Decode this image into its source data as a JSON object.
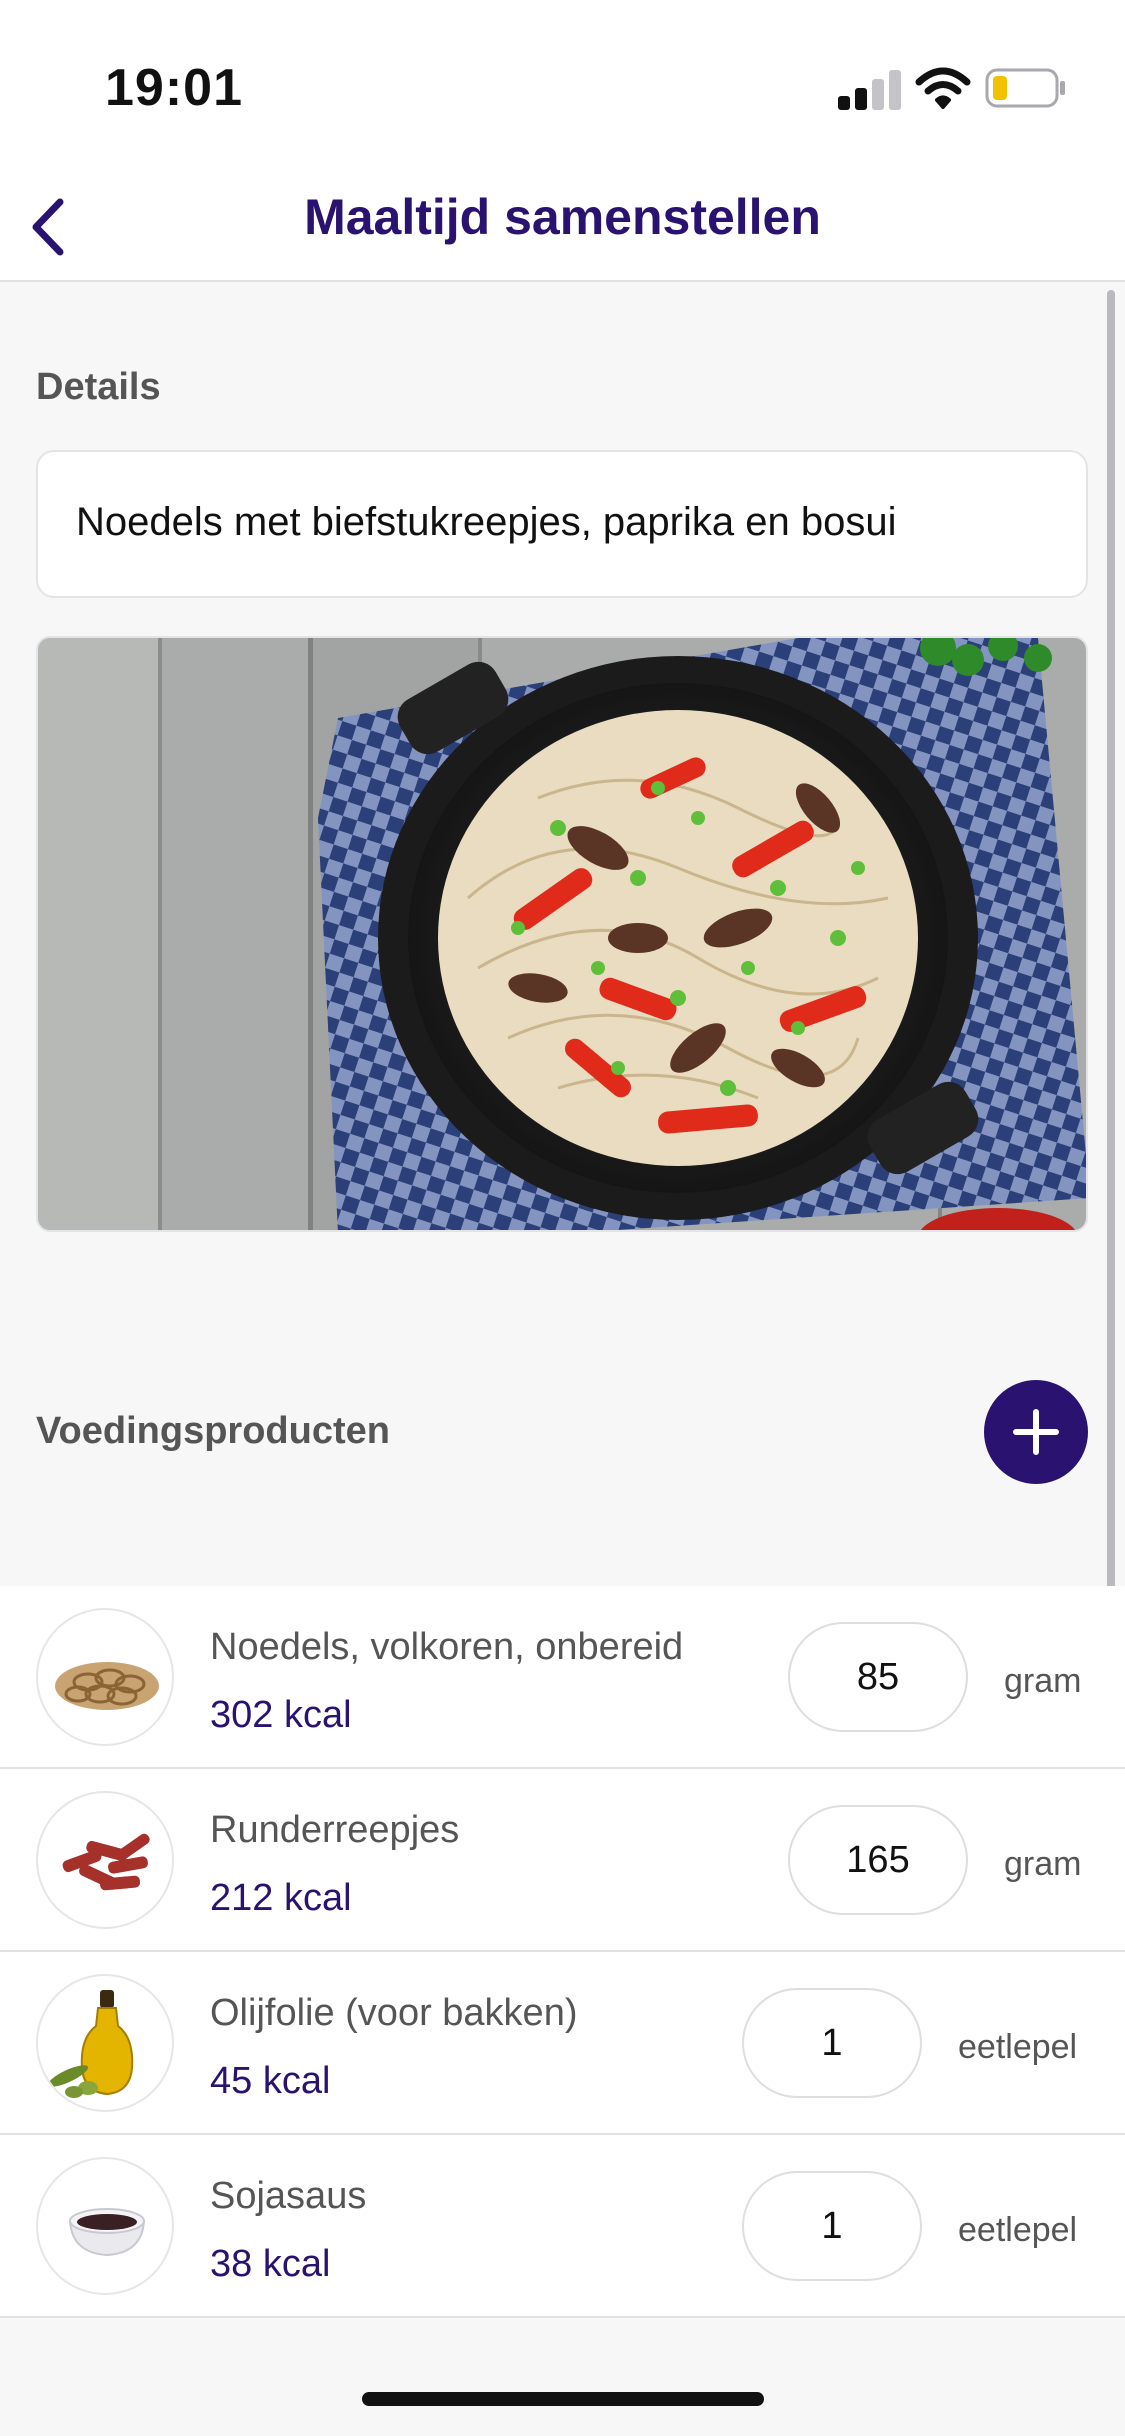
{
  "status": {
    "time": "19:01"
  },
  "nav": {
    "title": "Maaltijd samenstellen"
  },
  "details": {
    "label": "Details",
    "meal_name": "Noedels met biefstukreepjes, paprika en bosui"
  },
  "products": {
    "label": "Voedingsproducten",
    "items": [
      {
        "name": "Noedels, volkoren, onbereid",
        "kcal": "302 kcal",
        "amount": "85",
        "unit": "gram",
        "icon": "noodles-icon"
      },
      {
        "name": "Runderreepjes",
        "kcal": "212 kcal",
        "amount": "165",
        "unit": "gram",
        "icon": "beef-strips-icon"
      },
      {
        "name": "Olijfolie (voor bakken)",
        "kcal": "45 kcal",
        "amount": "1",
        "unit": "eetlepel",
        "icon": "olive-oil-icon"
      },
      {
        "name": "Sojasaus",
        "kcal": "38 kcal",
        "amount": "1",
        "unit": "eetlepel",
        "icon": "soy-sauce-icon"
      }
    ]
  },
  "colors": {
    "accent": "#2a1270",
    "background": "#f7f7f8"
  }
}
